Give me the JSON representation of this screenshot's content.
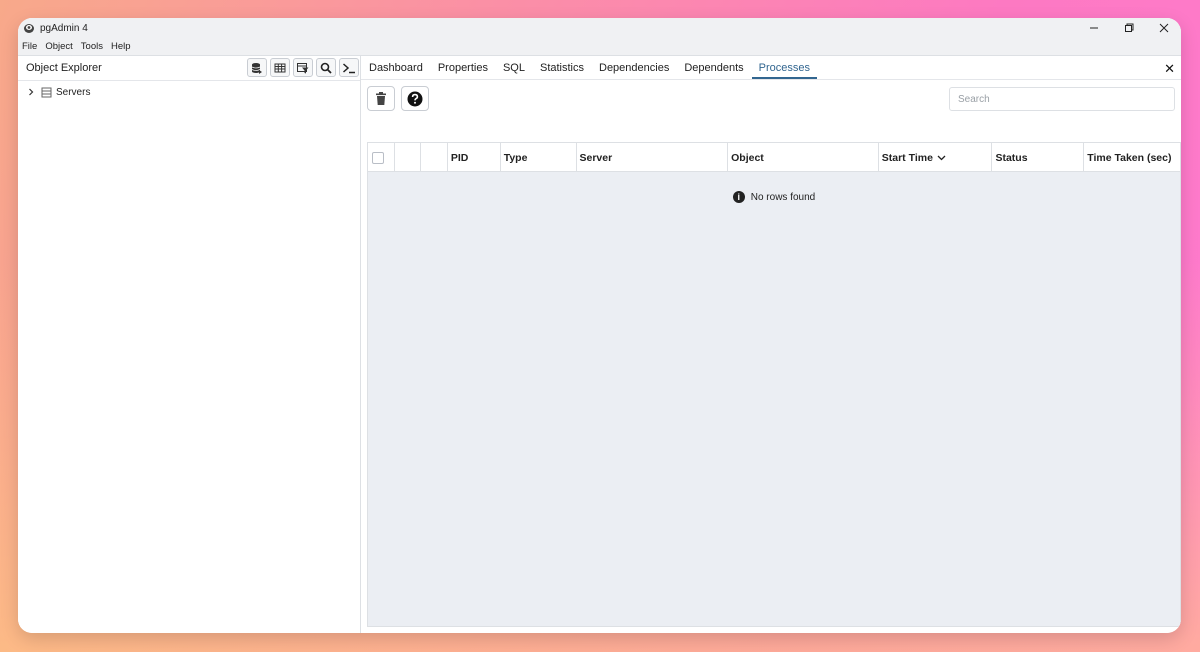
{
  "window": {
    "title": "pgAdmin 4"
  },
  "menu": [
    "File",
    "Object",
    "Tools",
    "Help"
  ],
  "object_explorer": {
    "title": "Object Explorer",
    "tree": [
      {
        "label": "Servers"
      }
    ]
  },
  "tabs": [
    {
      "label": "Dashboard"
    },
    {
      "label": "Properties"
    },
    {
      "label": "SQL"
    },
    {
      "label": "Statistics"
    },
    {
      "label": "Dependencies"
    },
    {
      "label": "Dependents"
    },
    {
      "label": "Processes",
      "active": true
    }
  ],
  "search": {
    "placeholder": "Search"
  },
  "grid": {
    "columns": [
      "PID",
      "Type",
      "Server",
      "Object",
      "Start Time",
      "Status",
      "Time Taken (sec)"
    ],
    "empty_message": "No rows found"
  },
  "colors": {
    "accent": "#326690",
    "grid_bg": "#ebeef3"
  }
}
